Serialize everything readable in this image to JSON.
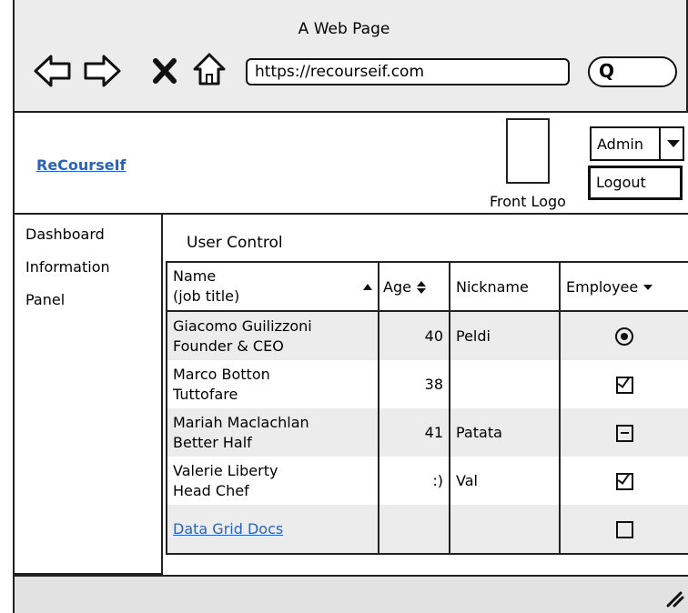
{
  "browser": {
    "title": "A Web Page",
    "url": "https://recourseif.com",
    "nav_icons": [
      "back-icon",
      "forward-icon",
      "close-icon",
      "home-icon"
    ],
    "search_icon": "search-icon"
  },
  "header": {
    "brand_link": "ReCourseIf",
    "logo_label": "Front Logo",
    "admin_select": {
      "value": "Admin"
    },
    "logout_label": "Logout"
  },
  "sidebar": {
    "items": [
      {
        "label": "Dashboard"
      },
      {
        "label": "Information"
      },
      {
        "label": "Panel"
      }
    ]
  },
  "main": {
    "section_title": "User Control",
    "grid": {
      "columns": [
        {
          "label_line1": "Name",
          "label_line2": "(job title)",
          "sort": "ascending"
        },
        {
          "label": "Age",
          "sort": "both"
        },
        {
          "label": "Nickname"
        },
        {
          "label": "Employee",
          "sort": "dropdown"
        }
      ],
      "rows": [
        {
          "name": "Giacomo Guilizzoni",
          "title": "Founder & CEO",
          "age": "40",
          "nickname": "Peldi",
          "employee": "radio-selected"
        },
        {
          "name": "Marco Botton",
          "title": "Tuttofare",
          "age": "38",
          "nickname": "",
          "employee": "checked"
        },
        {
          "name": "Mariah Maclachlan",
          "title": "Better Half",
          "age": "41",
          "nickname": "Patata",
          "employee": "partial"
        },
        {
          "name": "Valerie Liberty",
          "title": "Head Chef",
          "age": ":)",
          "nickname": "Val",
          "employee": "checked"
        }
      ],
      "footer_link": "Data Grid Docs",
      "footer_employee": "unchecked"
    }
  },
  "colors": {
    "chrome": "#ececec",
    "link": "#2a63b8",
    "row_alt": "#ececec"
  }
}
